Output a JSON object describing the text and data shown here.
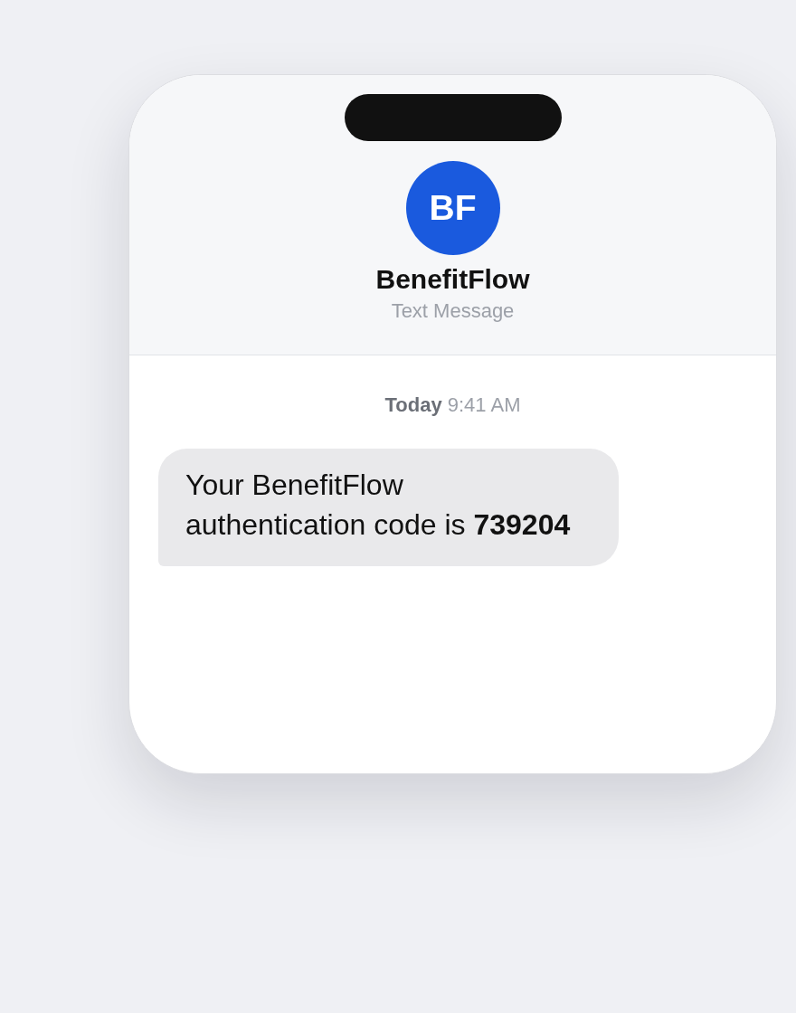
{
  "contact": {
    "initials": "BF",
    "name": "BenefitFlow",
    "subtitle": "Text Message"
  },
  "messages": [
    {
      "kind": "timestamp",
      "text": "**Today** 9:41 AM"
    },
    {
      "kind": "incoming",
      "text": "Your BenefitFlow authentication code is **739204**"
    }
  ]
}
